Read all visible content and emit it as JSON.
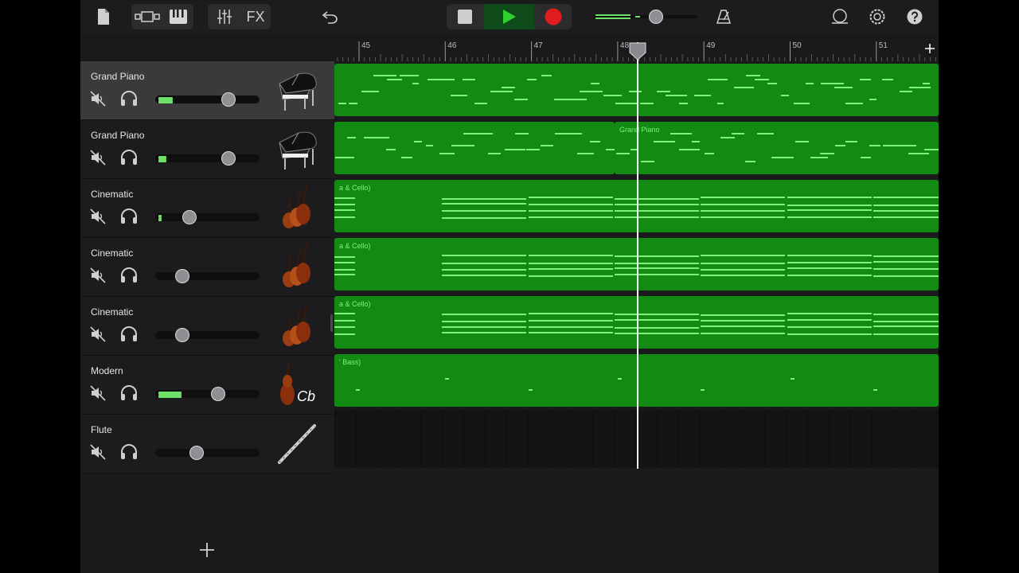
{
  "toolbar": {
    "fx_label": "FX",
    "icons": [
      "document-icon",
      "tracks-view-icon",
      "keyboard-icon",
      "mixer-icon",
      "undo-icon",
      "stop-icon",
      "play-icon",
      "record-icon",
      "master-volume",
      "metronome-icon",
      "loop-icon",
      "settings-icon",
      "help-icon"
    ],
    "master_volume_level": 0.6
  },
  "ruler": {
    "bars": [
      "45",
      "46",
      "47",
      "48",
      "49",
      "50",
      "51"
    ]
  },
  "tracks": [
    {
      "name": "Grand Piano",
      "instrument": "grand-piano-icon",
      "volume": 0.7,
      "meter": 0.14,
      "selected": true
    },
    {
      "name": "Grand Piano",
      "instrument": "grand-piano-icon",
      "volume": 0.7,
      "meter": 0.08,
      "selected": false
    },
    {
      "name": "Cinematic",
      "instrument": "strings-icon",
      "volume": 0.33,
      "meter": 0.03,
      "selected": false
    },
    {
      "name": "Cinematic",
      "instrument": "strings-icon",
      "volume": 0.26,
      "meter": 0,
      "selected": false
    },
    {
      "name": "Cinematic",
      "instrument": "strings-icon",
      "volume": 0.26,
      "meter": 0,
      "selected": false
    },
    {
      "name": "Modern",
      "instrument": "contrabass-icon",
      "instrument_label": "Cb",
      "volume": 0.6,
      "meter": 0.22,
      "selected": false
    },
    {
      "name": "Flute",
      "instrument": "flute-icon",
      "volume": 0.4,
      "meter": 0,
      "selected": false
    }
  ],
  "regions": [
    {
      "lane": 0,
      "name": ""
    },
    {
      "lane": 1,
      "name": ""
    },
    {
      "lane": 1,
      "name": "Grand Piano"
    },
    {
      "lane": 2,
      "name": "a & Cello)"
    },
    {
      "lane": 3,
      "name": "a & Cello)"
    },
    {
      "lane": 4,
      "name": "a & Cello)"
    },
    {
      "lane": 5,
      "name": "' Bass)"
    }
  ],
  "colors": {
    "region": "#138a14",
    "note": "#7ef279",
    "record": "#e01c1c",
    "play": "#2fd12f"
  }
}
